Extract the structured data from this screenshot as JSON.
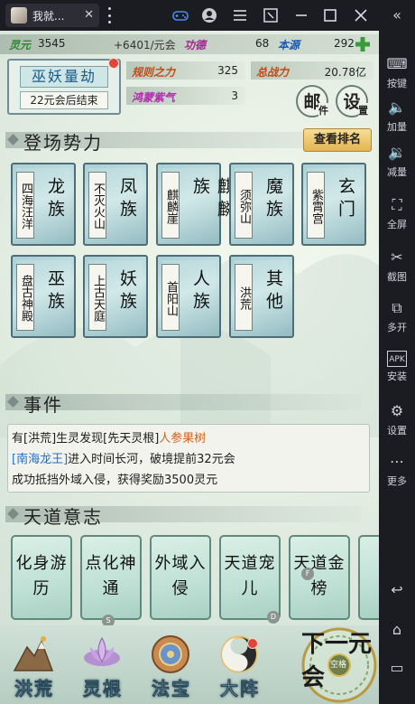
{
  "window": {
    "tab_title": "我就...",
    "tab_close": "✕"
  },
  "sidebar": [
    {
      "icon": "«",
      "label": ""
    },
    {
      "icon": "⌨",
      "label": "按键"
    },
    {
      "icon": "🔈",
      "label": "加量"
    },
    {
      "icon": "🔉",
      "label": "减量"
    },
    {
      "icon": "⛶",
      "label": "全屏"
    },
    {
      "icon": "✂",
      "label": "截图"
    },
    {
      "icon": "⧉",
      "label": "多开"
    },
    {
      "icon": "APK",
      "label": "安装"
    },
    {
      "icon": "⚙",
      "label": "设置"
    },
    {
      "icon": "⋯",
      "label": "更多"
    },
    {
      "icon": "↩",
      "label": ""
    },
    {
      "icon": "⌂",
      "label": ""
    },
    {
      "icon": "▭",
      "label": ""
    }
  ],
  "resources": {
    "lingyuan_label": "灵元",
    "lingyuan_value": "3545",
    "rate": "+6401/元会",
    "gongde_label": "功德",
    "gongde_value": "68",
    "benyuan_label": "本源",
    "benyuan_value": "292"
  },
  "kalpa": {
    "title": "巫妖量劫",
    "subtitle": "22元会后结束"
  },
  "stats": [
    {
      "label": "规则之力",
      "value": "325"
    },
    {
      "label": "总战力",
      "value": "20.78亿"
    },
    {
      "label": "鸿蒙紫气",
      "value": "3"
    }
  ],
  "buttons": {
    "mail_big": "邮",
    "mail_small": "件",
    "settings_big": "设",
    "settings_small": "置",
    "check_rank": "查看排名"
  },
  "sections": {
    "factions": "登场势力",
    "events": "事件",
    "will": "天道意志"
  },
  "factions": [
    {
      "tag": "四海汪洋",
      "name": "龙族"
    },
    {
      "tag": "不灭火山",
      "name": "凤族"
    },
    {
      "tag": "麒麟崖",
      "name": "麒麟族"
    },
    {
      "tag": "须弥山",
      "name": "魔族"
    },
    {
      "tag": "紫霄宫",
      "name": "玄门"
    },
    {
      "tag": "盘古神殿",
      "name": "巫族"
    },
    {
      "tag": "上古天庭",
      "name": "妖族"
    },
    {
      "tag": "首阳山",
      "name": "人族"
    },
    {
      "tag": "洪荒",
      "name": "其他"
    }
  ],
  "event": {
    "line1_a": "有[洪荒]生灵发现[先天灵根]",
    "line1_b": "人参果树",
    "line2_a": "[南海龙王]",
    "line2_b": "进入时间长河，破境提前32元会",
    "line3": "成功抵挡外域入侵，获得奖励3500灵元"
  },
  "will_cards": [
    {
      "text": "化身游历",
      "badge": ""
    },
    {
      "text": "点化神通",
      "badge": "S"
    },
    {
      "text": "外域入侵",
      "badge": ""
    },
    {
      "text": "天道宠儿",
      "badge": "D"
    },
    {
      "text": "天道金榜",
      "badge": "F"
    }
  ],
  "bottom_nav": [
    {
      "label": "洪荒"
    },
    {
      "label": "灵根"
    },
    {
      "label": "法宝"
    },
    {
      "label": "大阵"
    }
  ],
  "next": {
    "label": "下一元会",
    "hint": "空格"
  }
}
